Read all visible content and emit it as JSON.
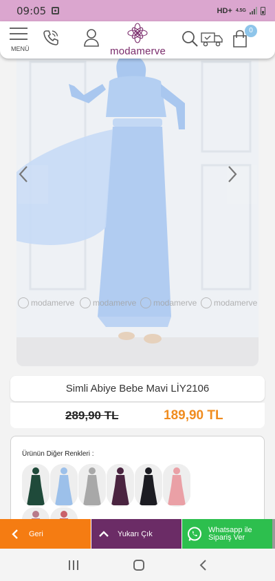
{
  "status_bar": {
    "time": "09:05",
    "network": "HD+",
    "network_type": "4.5G"
  },
  "header": {
    "menu_label": "MENÜ",
    "logo_text": "modamerve",
    "cart_count": "0"
  },
  "gallery": {
    "watermark_text": "modamerve",
    "accent_dress_color": "#aac8f0"
  },
  "product": {
    "title": "Simli Abiye Bebe Mavi LİY2106",
    "old_price": "289,90 TL",
    "new_price": "189,90 TL",
    "price_color": "#f08c1f"
  },
  "other_colors": {
    "label": "Ürünün Diğer Renkleri :",
    "swatches": [
      {
        "icon": "dress-dark-green",
        "color": "#1f4a3a"
      },
      {
        "icon": "dress-light-blue",
        "color": "#9cc0ea"
      },
      {
        "icon": "dress-grey",
        "color": "#a8a8a8"
      },
      {
        "icon": "dress-plum",
        "color": "#4a2440"
      },
      {
        "icon": "dress-black",
        "color": "#1c1c22"
      },
      {
        "icon": "dress-pink",
        "color": "#eaa0a6"
      },
      {
        "icon": "dress-mauve",
        "color": "#b87a8a"
      },
      {
        "icon": "dress-rose",
        "color": "#c9606a"
      }
    ]
  },
  "bottom_bar": {
    "back_label": "Geri",
    "top_label": "Yukarı Çık",
    "whatsapp_label": "Whatsapp ile Sipariş Ver",
    "colors": {
      "back": "#f57c12",
      "top": "#6b2c66",
      "whatsapp": "#2dbf4e"
    }
  }
}
